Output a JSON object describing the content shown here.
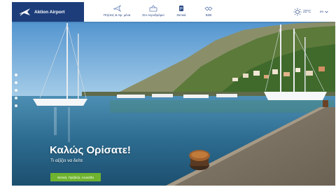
{
  "brand": {
    "name": "Aktion Airport",
    "color": "#1d3d7a"
  },
  "nav": {
    "items": [
      {
        "label": "Πτήσεις & Αφ. μένα",
        "icon": "airplane-icon"
      },
      {
        "label": "Στο Αεροδρόμιο",
        "icon": "airport-icon"
      },
      {
        "label": "Θετικά",
        "icon": "parking-icon"
      },
      {
        "label": "B2B",
        "icon": "handshake-icon"
      }
    ]
  },
  "weather": {
    "temp": "22°C",
    "icon": "sun-icon"
  },
  "language": {
    "label": "en"
  },
  "hero": {
    "title": "Καλώς Ορίσατε!",
    "subtitle": "Τι αξίζει να δείτε",
    "button_label": "Θετικά, Πρέβεζα, Λευκάδα",
    "slide_count": 5
  },
  "colors": {
    "accent": "#6fb32e",
    "nav_text": "#2b4a86"
  }
}
